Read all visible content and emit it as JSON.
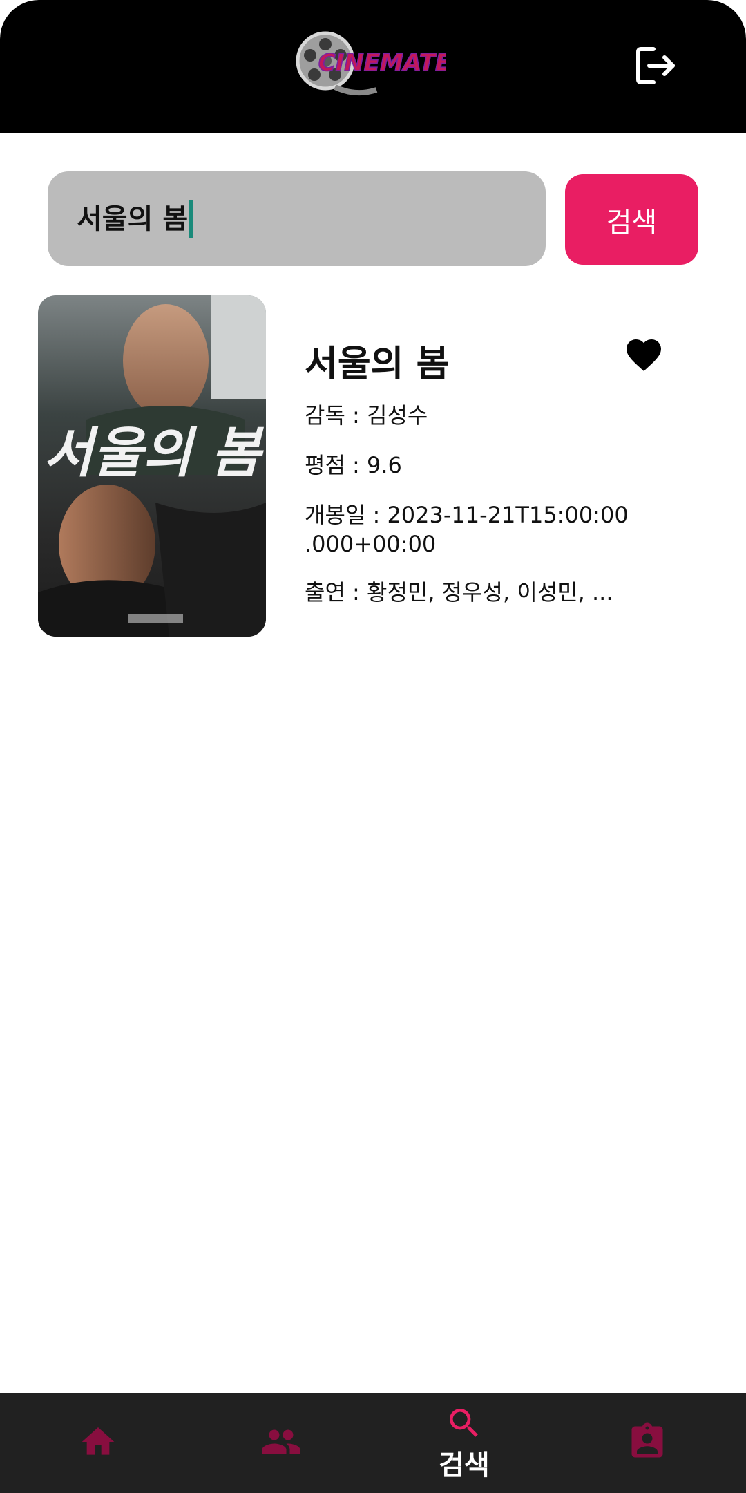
{
  "header": {
    "logo_text": "CINEMATE",
    "logout_icon": "logout-icon"
  },
  "search": {
    "query": "서울의 봄",
    "button_label": "검색"
  },
  "result": {
    "title": "서울의 봄",
    "director": "감독 : 김성수",
    "rating": "평점 : 9.6",
    "release_line1": "개봉일 : 2023-11-21T15:00:00",
    "release_line2": ".000+00:00",
    "cast": "출연 :  황정민, 정우성, 이성민, ...",
    "poster_title": "서울의 봄",
    "favorited": true
  },
  "nav": {
    "items": [
      {
        "icon": "home-icon",
        "active": false
      },
      {
        "icon": "people-icon",
        "active": false
      },
      {
        "icon": "search-icon",
        "label": "검색",
        "active": true
      },
      {
        "icon": "profile-badge-icon",
        "active": false
      }
    ]
  },
  "colors": {
    "accent": "#e91e63",
    "nav_inactive": "#880e3f",
    "header_bg": "#000000",
    "nav_bg": "#212121",
    "search_bg": "#bbbbbb",
    "caret": "#1a8a7a"
  }
}
